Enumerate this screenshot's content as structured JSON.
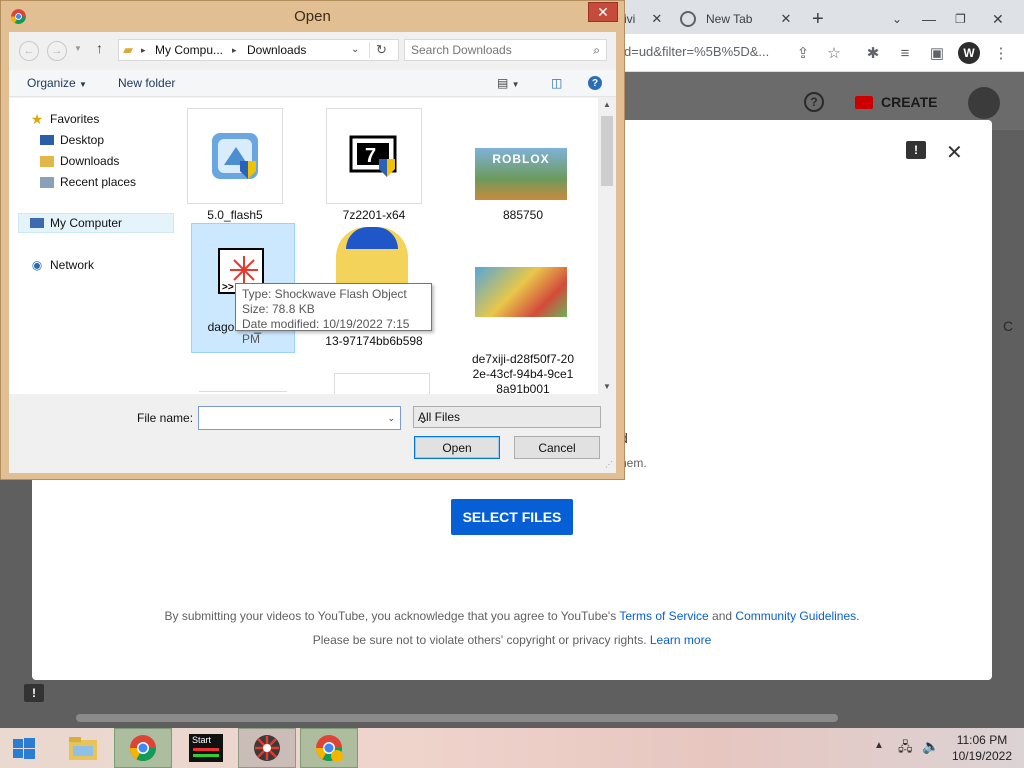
{
  "browser": {
    "tab_partial_label": "ivi",
    "new_tab_label": "New Tab",
    "url_text": "d=ud&filter=%5B%5D&...",
    "profile_initial": "W"
  },
  "youtube": {
    "create_label": "CREATE",
    "select_files_label": "SELECT FILES",
    "partial_text_1": "d",
    "partial_text_2": "hem.",
    "partial_text_3": "C",
    "footer_line1_prefix": "By submitting your videos to YouTube, you acknowledge that you agree to YouTube's",
    "terms_link": "Terms of Service",
    "footer_and": "and",
    "guidelines_link": "Community Guidelines",
    "footer_line1_suffix": ".",
    "footer_line2_prefix": "Please be sure not to violate others' copyright or privacy rights.",
    "learn_more_link": "Learn more"
  },
  "dialog": {
    "title": "Open",
    "close_label": "✕",
    "breadcrumb": [
      "My Compu...",
      "Downloads"
    ],
    "search_placeholder": "Search Downloads",
    "organize_label": "Organize",
    "new_folder_label": "New folder",
    "nav": {
      "favorites": "Favorites",
      "desktop": "Desktop",
      "downloads": "Downloads",
      "recent": "Recent places",
      "my_computer": "My Computer",
      "network": "Network"
    },
    "files": [
      {
        "name": "5.0_flash5"
      },
      {
        "name": "7z2201-x64"
      },
      {
        "name": "885750"
      },
      {
        "name": "dagobah_...ld"
      },
      {
        "name": "...59-3bae-4feb-a013-97174bb6b598"
      },
      {
        "name": "de7xiji-d28f50f7-202e-43cf-94b4-9ce18a91b001"
      }
    ],
    "thumb_labels": {
      "roblox": "ROBLOX",
      "sevenzip": "7"
    },
    "tooltip": {
      "type": "Type: Shockwave Flash Object",
      "size": "Size: 78.8 KB",
      "modified": "Date modified: 10/19/2022 7:15 PM"
    },
    "file_name_label": "File name:",
    "file_name_value": "",
    "file_type": "All Files",
    "open_label": "Open",
    "cancel_label": "Cancel"
  },
  "taskbar": {
    "start_tile_label": "Start",
    "time": "11:06 PM",
    "date": "10/19/2022"
  },
  "colors": {
    "dialog_frame": "#e2bf92",
    "yt_blue": "#065fd4",
    "close_red": "#c74b3d"
  }
}
